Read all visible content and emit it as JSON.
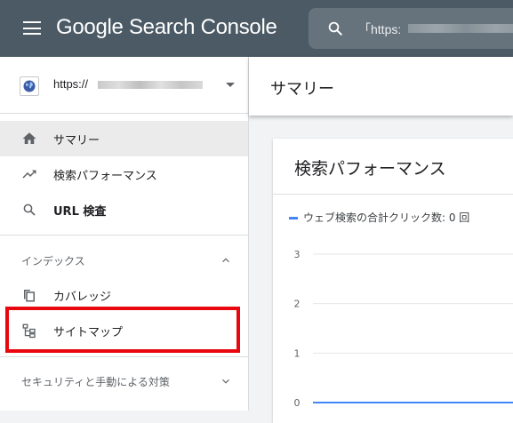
{
  "app": {
    "brand": "Google Search Console",
    "search_text": "「https:"
  },
  "property": {
    "url_prefix": "https://"
  },
  "nav": {
    "items": [
      {
        "label": "サマリー",
        "icon": "home-icon",
        "active": true
      },
      {
        "label": "検索パフォーマンス",
        "icon": "trending-up-icon"
      },
      {
        "label": "URL 検査",
        "icon": "search-icon"
      }
    ],
    "index_section": "インデックス",
    "index_items": [
      {
        "label": "カバレッジ",
        "icon": "copy-icon"
      },
      {
        "label": "サイトマップ",
        "icon": "sitemap-icon"
      }
    ],
    "security_section": "セキュリティと手動による対策"
  },
  "header": {
    "title": "サマリー"
  },
  "card": {
    "title": "検索パフォーマンス",
    "legend": "ウェブ検索の合計クリック数: 0 回"
  },
  "colors": {
    "topbar": "#4b5a65",
    "highlight": "#e8070f",
    "series": "#4285f4"
  },
  "chart_data": {
    "type": "line",
    "series": [
      {
        "name": "ウェブ検索の合計クリック数",
        "values": [
          0,
          0
        ]
      }
    ],
    "yticks": [
      "3",
      "2",
      "1",
      "0"
    ],
    "ylim": [
      0,
      3
    ],
    "grid": true,
    "legend": "top-left"
  }
}
